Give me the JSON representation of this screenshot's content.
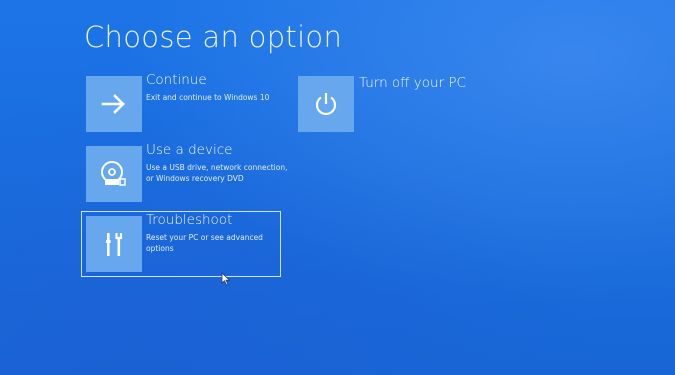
{
  "page": {
    "title": "Choose an option"
  },
  "options": [
    {
      "id": "continue",
      "title": "Continue",
      "description": "Exit and continue to Windows 10",
      "icon": "arrow-right-icon"
    },
    {
      "id": "use-device",
      "title": "Use a device",
      "description": "Use a USB drive, network connection, or Windows recovery DVD",
      "icon": "disc-drive-icon"
    },
    {
      "id": "troubleshoot",
      "title": "Troubleshoot",
      "description": "Reset your PC or see advanced options",
      "icon": "tools-icon",
      "selected": true
    },
    {
      "id": "turn-off",
      "title": "Turn off your PC",
      "description": "",
      "icon": "power-icon"
    }
  ],
  "colors": {
    "background": "#1a6fe0",
    "tile": "#66a7ee",
    "text": "#ffffff",
    "selection_outline": "#cfe3ff"
  }
}
